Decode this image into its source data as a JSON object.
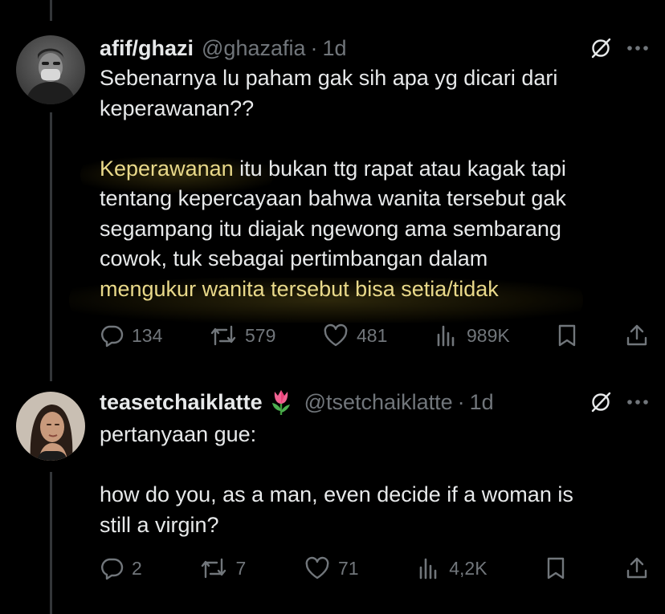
{
  "tweets": [
    {
      "display_name": "afif/ghazi",
      "handle": "@ghazafia",
      "separator": "·",
      "time": "1d",
      "line1": "Sebenarnya lu paham gak sih apa yg dicari dari",
      "line2": "keperawanan??",
      "p2_hl1": "Keperawanan",
      "p2_l1": " itu bukan ttg rapat atau kagak tapi",
      "p2_l2": "tentang kepercayaan bahwa wanita tersebut gak",
      "p2_l3": "segampang itu diajak ngewong ama sembarang",
      "p2_l4": "cowok, tuk sebagai pertimbangan dalam",
      "p2_hl2": "mengukur wanita tersebut bisa setia/tidak",
      "replies": "134",
      "reposts": "579",
      "likes": "481",
      "views": "989K"
    },
    {
      "display_name": "teasetchaiklatte",
      "handle": "@tsetchaiklatte",
      "separator": "·",
      "time": "1d",
      "line1": "pertanyaan gue:",
      "p2_l1": "how do you, as a man, even decide if a woman is",
      "p2_l2": "still a virgin?",
      "replies": "2",
      "reposts": "7",
      "likes": "71",
      "views": "4,2K"
    }
  ],
  "icons": {
    "grok": "grok-icon",
    "more": "more-icon",
    "reply": "reply-icon",
    "repost": "repost-icon",
    "like": "like-icon",
    "views": "views-icon",
    "bookmark": "bookmark-icon",
    "share": "share-icon",
    "emoji": "tulip-emoji"
  },
  "colors": {
    "background": "#000000",
    "text": "#e7e9ea",
    "muted": "#71767b",
    "highlight_text": "#e9d98a",
    "thread_line": "#333639"
  }
}
